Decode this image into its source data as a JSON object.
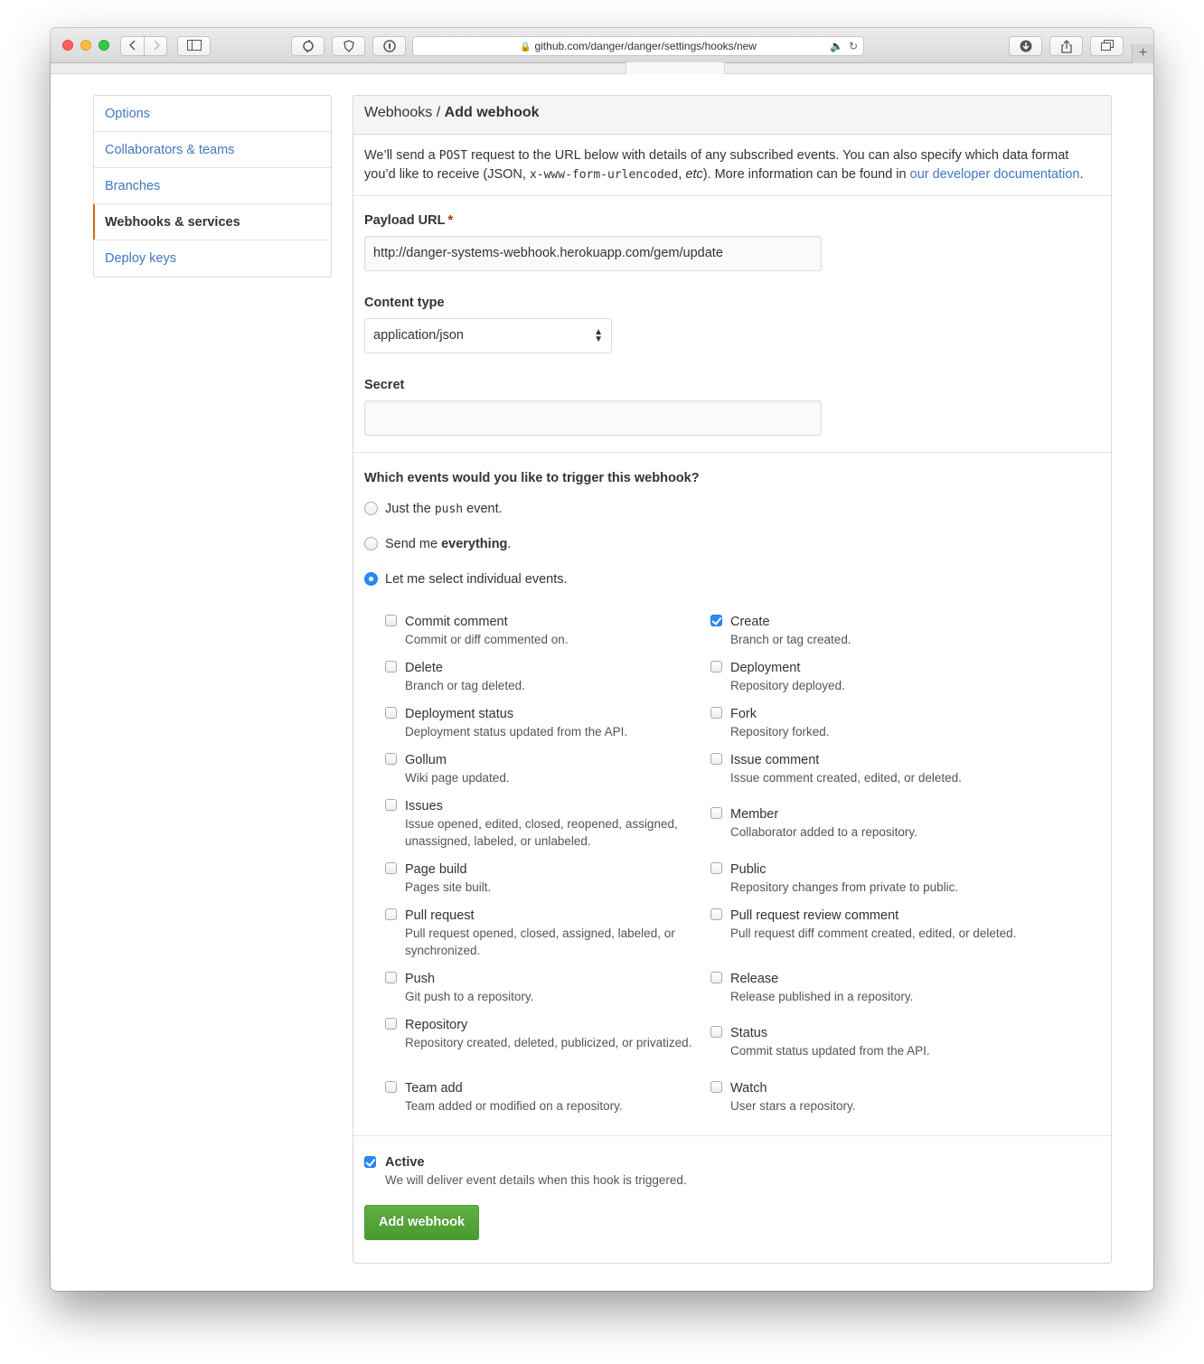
{
  "browser": {
    "url": "github.com/danger/danger/settings/hooks/new"
  },
  "sidebar": {
    "items": [
      {
        "label": "Options"
      },
      {
        "label": "Collaborators & teams"
      },
      {
        "label": "Branches"
      },
      {
        "label": "Webhooks & services"
      },
      {
        "label": "Deploy keys"
      }
    ],
    "selected": "Webhooks & services"
  },
  "header": {
    "breadcrumb_parent": "Webhooks",
    "separator": "/",
    "title": "Add webhook"
  },
  "intro": {
    "part1": "We’ll send a ",
    "method": "POST",
    "part2": " request to the URL below with details of any subscribed events. You can also specify which data format you’d like to receive (JSON, ",
    "format": "x-www-form-urlencoded",
    "part3": ", ",
    "etc": "etc",
    "part4": "). More information can be found in ",
    "link": "our developer documentation",
    "part5": "."
  },
  "form": {
    "payload_label": "Payload URL",
    "required_mark": "*",
    "payload_value": "http://danger-systems-webhook.herokuapp.com/gem/update",
    "content_type_label": "Content type",
    "content_type_value": "application/json",
    "secret_label": "Secret",
    "secret_value": ""
  },
  "events": {
    "question": "Which events would you like to trigger this webhook?",
    "radio_push_prefix": "Just the ",
    "radio_push_code": "push",
    "radio_push_suffix": " event.",
    "radio_all_prefix": "Send me ",
    "radio_all_bold": "everything",
    "radio_all_suffix": ".",
    "radio_individual": "Let me select individual events.",
    "selected_radio": "individual",
    "items": [
      {
        "title": "Commit comment",
        "desc": "Commit or diff commented on.",
        "checked": false
      },
      {
        "title": "Create",
        "desc": "Branch or tag created.",
        "checked": true
      },
      {
        "title": "Delete",
        "desc": "Branch or tag deleted.",
        "checked": false
      },
      {
        "title": "Deployment",
        "desc": "Repository deployed.",
        "checked": false
      },
      {
        "title": "Deployment status",
        "desc": "Deployment status updated from the API.",
        "checked": false
      },
      {
        "title": "Fork",
        "desc": "Repository forked.",
        "checked": false
      },
      {
        "title": "Gollum",
        "desc": "Wiki page updated.",
        "checked": false
      },
      {
        "title": "Issue comment",
        "desc": "Issue comment created, edited, or deleted.",
        "checked": false
      },
      {
        "title": "Issues",
        "desc": "Issue opened, edited, closed, reopened, assigned, unassigned, labeled, or unlabeled.",
        "checked": false
      },
      {
        "title": "Member",
        "desc": "Collaborator added to a repository.",
        "checked": false
      },
      {
        "title": "Page build",
        "desc": "Pages site built.",
        "checked": false
      },
      {
        "title": "Public",
        "desc": "Repository changes from private to public.",
        "checked": false
      },
      {
        "title": "Pull request",
        "desc": "Pull request opened, closed, assigned, labeled, or synchronized.",
        "checked": false
      },
      {
        "title": "Pull request review comment",
        "desc": "Pull request diff comment created, edited, or deleted.",
        "checked": false
      },
      {
        "title": "Push",
        "desc": "Git push to a repository.",
        "checked": false
      },
      {
        "title": "Release",
        "desc": "Release published in a repository.",
        "checked": false
      },
      {
        "title": "Repository",
        "desc": "Repository created, deleted, publicized, or privatized.",
        "checked": false
      },
      {
        "title": "Status",
        "desc": "Commit status updated from the API.",
        "checked": false
      },
      {
        "title": "Team add",
        "desc": "Team added or modified on a repository.",
        "checked": false
      },
      {
        "title": "Watch",
        "desc": "User stars a repository.",
        "checked": false
      }
    ]
  },
  "active": {
    "title": "Active",
    "desc": "We will deliver event details when this hook is triggered.",
    "checked": true
  },
  "submit_label": "Add webhook",
  "colors": {
    "link": "#4078c0",
    "accent_orange": "#d26911",
    "checkbox_blue": "#2a8af5",
    "button_green": "#55a532"
  }
}
